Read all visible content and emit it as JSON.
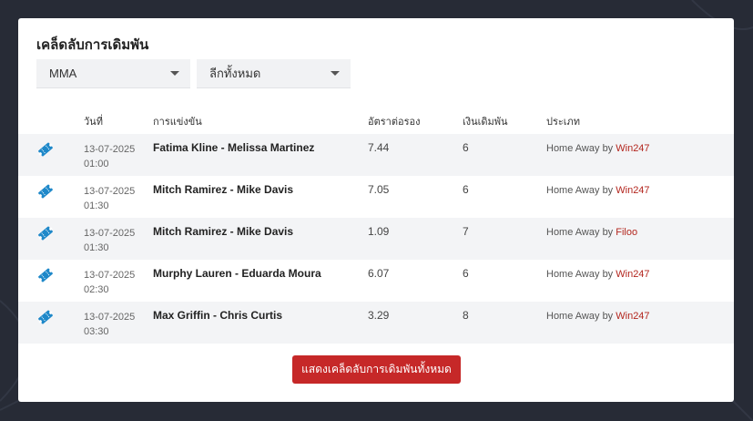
{
  "title": "เคล็ดลับการเดิมพัน",
  "filters": {
    "sport": "MMA",
    "league": "ลีกทั้งหมด"
  },
  "columns": {
    "date": "วันที่",
    "match": "การแข่งขัน",
    "odds": "อัตราต่อรอง",
    "stake": "เงินเดิมพัน",
    "type": "ประเภท"
  },
  "rows": [
    {
      "date": "13-07-2025",
      "time": "01:00",
      "match": "Fatima Kline - Melissa Martinez",
      "odds": "7.44",
      "stake": "6",
      "type": "Home Away",
      "by": "by",
      "bookmaker": "Win247"
    },
    {
      "date": "13-07-2025",
      "time": "01:30",
      "match": "Mitch Ramirez - Mike Davis",
      "odds": "7.05",
      "stake": "6",
      "type": "Home Away",
      "by": "by",
      "bookmaker": "Win247"
    },
    {
      "date": "13-07-2025",
      "time": "01:30",
      "match": "Mitch Ramirez - Mike Davis",
      "odds": "1.09",
      "stake": "7",
      "type": "Home Away",
      "by": "by",
      "bookmaker": "Filoo"
    },
    {
      "date": "13-07-2025",
      "time": "02:30",
      "match": "Murphy Lauren - Eduarda Moura",
      "odds": "6.07",
      "stake": "6",
      "type": "Home Away",
      "by": "by",
      "bookmaker": "Win247"
    },
    {
      "date": "13-07-2025",
      "time": "03:30",
      "match": "Max Griffin - Chris Curtis",
      "odds": "3.29",
      "stake": "8",
      "type": "Home Away",
      "by": "by",
      "bookmaker": "Win247"
    }
  ],
  "show_all_button": "แสดงเคล็ดลับการเดิมพันทั้งหมด",
  "colors": {
    "accent": "#c62828",
    "ticket_icon": "#1e88c9",
    "bookmaker_link": "#b3261e"
  },
  "icons": {
    "row_icon": "ticket-icon",
    "dropdown": "caret-down-icon"
  }
}
